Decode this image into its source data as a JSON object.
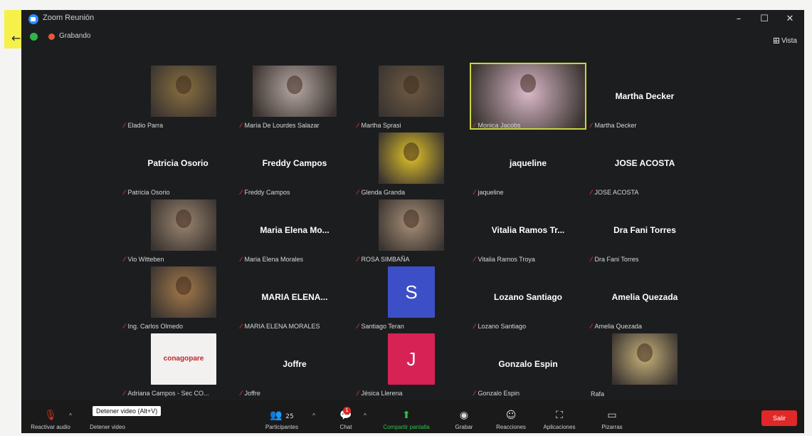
{
  "window": {
    "title": "Zoom Reunión",
    "recording": "Grabando",
    "view": "Vista"
  },
  "tiles": [
    {
      "row": 0,
      "col": 0,
      "label": "Eladio Parra",
      "video": true,
      "photo_color": "#8a7040"
    },
    {
      "row": 0,
      "col": 1,
      "label": "María De Lourdes Salazar",
      "video": true,
      "photo_color": "#b8a9a4"
    },
    {
      "row": 0,
      "col": 2,
      "label": "Martha Sprasi",
      "video": true,
      "photo_color": "#6e5a42"
    },
    {
      "row": 0,
      "col": 3,
      "label": "Monica Jacobs",
      "video": true,
      "active": true,
      "photo_color": "#d9b8c8"
    },
    {
      "row": 0,
      "col": 4,
      "name": "Martha Decker",
      "label": "Martha Decker"
    },
    {
      "row": 1,
      "col": 0,
      "name": "Patricia Osorio",
      "label": "Patricia Osorio"
    },
    {
      "row": 1,
      "col": 1,
      "name": "Freddy Campos",
      "label": "Freddy Campos"
    },
    {
      "row": 1,
      "col": 2,
      "label": "Glenda Granda",
      "video": true,
      "photo_color": "#e2c32a"
    },
    {
      "row": 1,
      "col": 3,
      "name": "jaqueline",
      "label": "jaqueline"
    },
    {
      "row": 1,
      "col": 4,
      "name": "JOSE ACOSTA",
      "label": "JOSE ACOSTA"
    },
    {
      "row": 2,
      "col": 0,
      "label": "Vio Witteben",
      "video": true,
      "photo_color": "#9b8570"
    },
    {
      "row": 2,
      "col": 1,
      "name": "Maria Elena Mo...",
      "label": "Maria Elena Morales"
    },
    {
      "row": 2,
      "col": 2,
      "label": "ROSA SIMBAÑA",
      "video": true,
      "photo_color": "#a89078"
    },
    {
      "row": 2,
      "col": 3,
      "name": "Vitalia Ramos Tr...",
      "label": "Vitalia Ramos Troya"
    },
    {
      "row": 2,
      "col": 4,
      "name": "Dra Fani Torres",
      "label": "Dra Fani Torres"
    },
    {
      "row": 3,
      "col": 0,
      "label": "Ing. Carlos Olmedo",
      "video": true,
      "photo_color": "#a4794a"
    },
    {
      "row": 3,
      "col": 1,
      "name": "MARIA ELENA...",
      "label": "MARIA ELENA MORALES"
    },
    {
      "row": 3,
      "col": 2,
      "label": "Santiago Teran",
      "avatar": "S",
      "avatar_color": "#3d4fc6"
    },
    {
      "row": 3,
      "col": 3,
      "name": "Lozano Santiago",
      "label": "Lozano Santiago"
    },
    {
      "row": 3,
      "col": 4,
      "name": "Amelia Quezada",
      "label": "Amelia Quezada"
    },
    {
      "row": 4,
      "col": 0,
      "label": "Adriana Campos - Sec CO...",
      "video": true,
      "photo_color": "#f3f1ef",
      "logo": "conagopare"
    },
    {
      "row": 4,
      "col": 1,
      "name": "Joffre",
      "label": "Joffre"
    },
    {
      "row": 4,
      "col": 2,
      "label": "Jésica Llerena",
      "avatar": "J",
      "avatar_color": "#d62254"
    },
    {
      "row": 4,
      "col": 3,
      "name": "Gonzalo Espin",
      "label": "Gonzalo Espin"
    },
    {
      "row": 4,
      "col": 4,
      "label": "Rafa",
      "video": true,
      "photo_color": "#c8b27a",
      "nomic": true
    }
  ],
  "toolbar": {
    "audio": "Reactivar audio",
    "video": "Detener video",
    "tooltip": "Detener video (Alt+V)",
    "participants": "Participantes",
    "participants_count": "25",
    "chat": "Chat",
    "chat_badge": "1",
    "share": "Compartir pantalla",
    "record": "Grabar",
    "reactions": "Reacciones",
    "apps": "Aplicaciones",
    "whiteboards": "Pizarras",
    "leave": "Salir"
  }
}
